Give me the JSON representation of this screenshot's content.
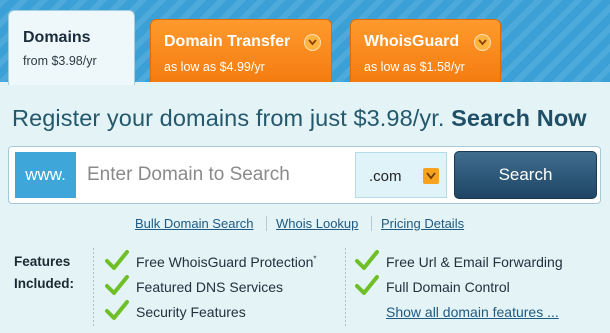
{
  "tabs": [
    {
      "title": "Domains",
      "subtitle": "from $3.98/yr"
    },
    {
      "title": "Domain Transfer",
      "subtitle": "as low as $4.99/yr"
    },
    {
      "title": "WhoisGuard",
      "subtitle": "as low as $1.58/yr"
    }
  ],
  "headline": {
    "text": "Register your domains from just $3.98/yr.",
    "cta": "Search Now"
  },
  "search": {
    "prefix": "www.",
    "placeholder": "Enter Domain to Search",
    "value": "",
    "tld": ".com",
    "button_label": "Search"
  },
  "links": [
    "Bulk Domain Search",
    "Whois Lookup",
    "Pricing Details"
  ],
  "features": {
    "label_line1": "Features",
    "label_line2": "Included:",
    "left": [
      "Free WhoisGuard Protection",
      "Featured DNS Services",
      "Security Features"
    ],
    "left_note": "*",
    "right": [
      "Free Url & Email Forwarding",
      "Full Domain Control"
    ],
    "more_link": "Show all domain features ..."
  },
  "colors": {
    "accent_orange": "#f47c10",
    "accent_blue": "#3fa6d9",
    "button_navy": "#1f4565",
    "check_green": "#6fbf27"
  }
}
